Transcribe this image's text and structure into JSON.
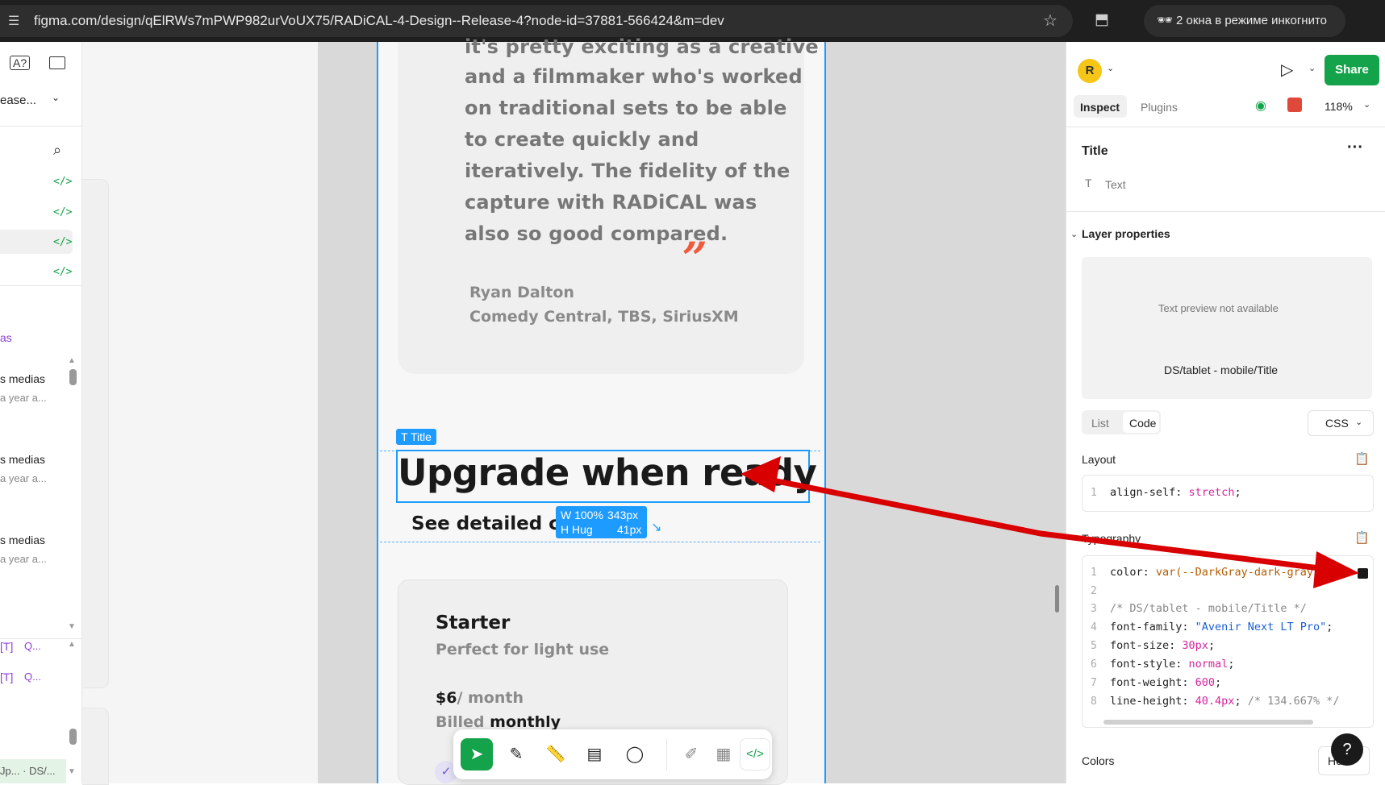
{
  "browser": {
    "url": "figma.com/design/qElRWs7mPWP982urVoUX75/RADiCAL-4-Design--Release-4?node-id=37881-566424&m=dev",
    "incognito_label": "2 окна в режиме инкогнито"
  },
  "left_panel": {
    "file_name": "ease...",
    "items": [
      {
        "label": "as"
      },
      {
        "label": "s medias",
        "sub": "a year a..."
      },
      {
        "label": "s medias",
        "sub": "a year a..."
      },
      {
        "label": "s medias",
        "sub": "a year a..."
      }
    ],
    "layer_rows": [
      {
        "label": "Q..."
      },
      {
        "label": "Q..."
      }
    ],
    "bottom_item": "Jp... · DS/..."
  },
  "canvas": {
    "quote_lines": [
      "it's pretty exciting as a creative",
      "and a filmmaker who's worked",
      "on traditional sets to be able",
      "to create quickly and",
      "iteratively. The fidelity of the",
      "capture with RADiCAL was",
      "also so good compared."
    ],
    "quote_mark": "”",
    "author_name": "Ryan Dalton",
    "author_company": "Comedy Central, TBS, SiriusXM",
    "title_badge": "Title",
    "title": "Upgrade when ready",
    "subtitle": "See detailed con",
    "dimension_badge": {
      "w_label": "W 100%",
      "w_value": "343px",
      "h_label": "H Hug",
      "h_value": "41px"
    },
    "starter": {
      "title": "Starter",
      "subtitle": "Perfect for light use",
      "price": "$6",
      "per": "/ month",
      "billed_prefix": "Billed",
      "billed_value": "monthly"
    }
  },
  "right_panel": {
    "avatar_letter": "R",
    "share_label": "Share",
    "tabs": [
      "Inspect",
      "Plugins"
    ],
    "zoom": "118%",
    "selection_title": "Title",
    "selection_type": "Text",
    "section_layer": "Layer properties",
    "preview_unavailable": "Text preview not available",
    "style_name": "DS/tablet - mobile/Title",
    "view_tabs": [
      "List",
      "Code"
    ],
    "language": "CSS",
    "layout_label": "Layout",
    "layout_code": {
      "prop": "align-self",
      "value": "stretch"
    },
    "typography_label": "Typography",
    "typography_code": [
      {
        "n": "1",
        "prop": "color",
        "value": "var(--DarkGray-dark-gray-900, "
      },
      {
        "n": "2"
      },
      {
        "n": "3",
        "comment": "/* DS/tablet - mobile/Title */"
      },
      {
        "n": "4",
        "prop": "font-family",
        "value": "\"Avenir Next LT Pro\""
      },
      {
        "n": "5",
        "prop": "font-size",
        "value": "30px"
      },
      {
        "n": "6",
        "prop": "font-style",
        "value": "normal"
      },
      {
        "n": "7",
        "prop": "font-weight",
        "value": "600"
      },
      {
        "n": "8",
        "prop": "line-height",
        "value": "40.4px",
        "comment": "/* 134.667% */"
      }
    ],
    "colors_label": "Colors",
    "colors_button": "He...",
    "help": "?"
  },
  "colors": {
    "accent_blue": "#1e9bff",
    "share_green": "#14a34a",
    "arrow_red": "#d80000",
    "quote_orange": "#f05a3a"
  }
}
